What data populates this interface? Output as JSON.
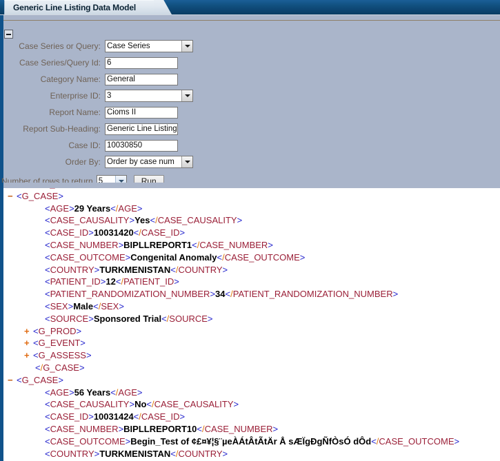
{
  "window": {
    "tab_title": "Generic Line Listing Data Model",
    "collapse_toggle": "minus"
  },
  "form": {
    "fields": [
      {
        "label": "Case Series or Query:",
        "type": "select",
        "value": "Case Series"
      },
      {
        "label": "Case Series/Query Id:",
        "type": "text",
        "value": "6"
      },
      {
        "label": "Category Name:",
        "type": "text",
        "value": "General"
      },
      {
        "label": "Enterprise ID:",
        "type": "select",
        "value": "3"
      },
      {
        "label": "Report Name:",
        "type": "text",
        "value": "Cioms II"
      },
      {
        "label": "Report Sub-Heading:",
        "type": "text",
        "value": "Generic Line Listing"
      },
      {
        "label": "Case ID:",
        "type": "text",
        "value": "10030850"
      },
      {
        "label": "Order By:",
        "type": "select",
        "value": "Order by case num"
      }
    ],
    "rows_label": "Number of rows to return",
    "rows_value": "5",
    "run_label": "Run"
  },
  "xml": {
    "lines": [
      {
        "indent": 1,
        "toggle": "",
        "kind": "close",
        "tag": "G_COVERPG"
      },
      {
        "indent": 0,
        "toggle": "minus",
        "kind": "open",
        "tag": "G_CASE"
      },
      {
        "indent": 2,
        "toggle": "",
        "kind": "pair",
        "tag": "AGE",
        "value": "29 Years"
      },
      {
        "indent": 2,
        "toggle": "",
        "kind": "pair",
        "tag": "CASE_CAUSALITY",
        "value": "Yes"
      },
      {
        "indent": 2,
        "toggle": "",
        "kind": "pair",
        "tag": "CASE_ID",
        "value": "10031420"
      },
      {
        "indent": 2,
        "toggle": "",
        "kind": "pair",
        "tag": "CASE_NUMBER",
        "value": "BIPLLREPORT1"
      },
      {
        "indent": 2,
        "toggle": "",
        "kind": "pair",
        "tag": "CASE_OUTCOME",
        "value": "Congenital Anomaly"
      },
      {
        "indent": 2,
        "toggle": "",
        "kind": "pair",
        "tag": "COUNTRY",
        "value": "TURKMENISTAN"
      },
      {
        "indent": 2,
        "toggle": "",
        "kind": "pair",
        "tag": "PATIENT_ID",
        "value": "12"
      },
      {
        "indent": 2,
        "toggle": "",
        "kind": "pair",
        "tag": "PATIENT_RANDOMIZATION_NUMBER",
        "value": "34"
      },
      {
        "indent": 2,
        "toggle": "",
        "kind": "pair",
        "tag": "SEX",
        "value": "Male"
      },
      {
        "indent": 2,
        "toggle": "",
        "kind": "pair",
        "tag": "SOURCE",
        "value": "Sponsored Trial"
      },
      {
        "indent": 1,
        "toggle": "plus",
        "kind": "open",
        "tag": "G_PROD"
      },
      {
        "indent": 1,
        "toggle": "plus",
        "kind": "open",
        "tag": "G_EVENT"
      },
      {
        "indent": 1,
        "toggle": "plus",
        "kind": "open",
        "tag": "G_ASSESS"
      },
      {
        "indent": 1,
        "toggle": "",
        "kind": "close",
        "tag": "G_CASE"
      },
      {
        "indent": 0,
        "toggle": "minus",
        "kind": "open",
        "tag": "G_CASE"
      },
      {
        "indent": 2,
        "toggle": "",
        "kind": "pair",
        "tag": "AGE",
        "value": "56 Years"
      },
      {
        "indent": 2,
        "toggle": "",
        "kind": "pair",
        "tag": "CASE_CAUSALITY",
        "value": "No"
      },
      {
        "indent": 2,
        "toggle": "",
        "kind": "pair",
        "tag": "CASE_ID",
        "value": "10031424"
      },
      {
        "indent": 2,
        "toggle": "",
        "kind": "pair",
        "tag": "CASE_NUMBER",
        "value": "BIPLLREPORT10"
      },
      {
        "indent": 2,
        "toggle": "",
        "kind": "pair",
        "tag": "CASE_OUTCOME",
        "value": "Begin_Test of ¢£¤¥¦§¨µeÀÁtÂtÃtÄr Å sÆÏgÐgÑfÒsÓ dÔd"
      },
      {
        "indent": 2,
        "toggle": "",
        "kind": "pair",
        "tag": "COUNTRY",
        "value": "TURKMENISTAN"
      }
    ]
  },
  "colors": {
    "tab_bar": "#11507f",
    "panel_bg": "#aab5ca",
    "left_stripe": "#10528a",
    "label_text": "#6f6256",
    "xml_bracket": "#2222cc",
    "xml_tag": "#9a1f37",
    "xml_slash": "#e07b10",
    "xml_value": "#000000",
    "toggle": "#d2691e"
  }
}
